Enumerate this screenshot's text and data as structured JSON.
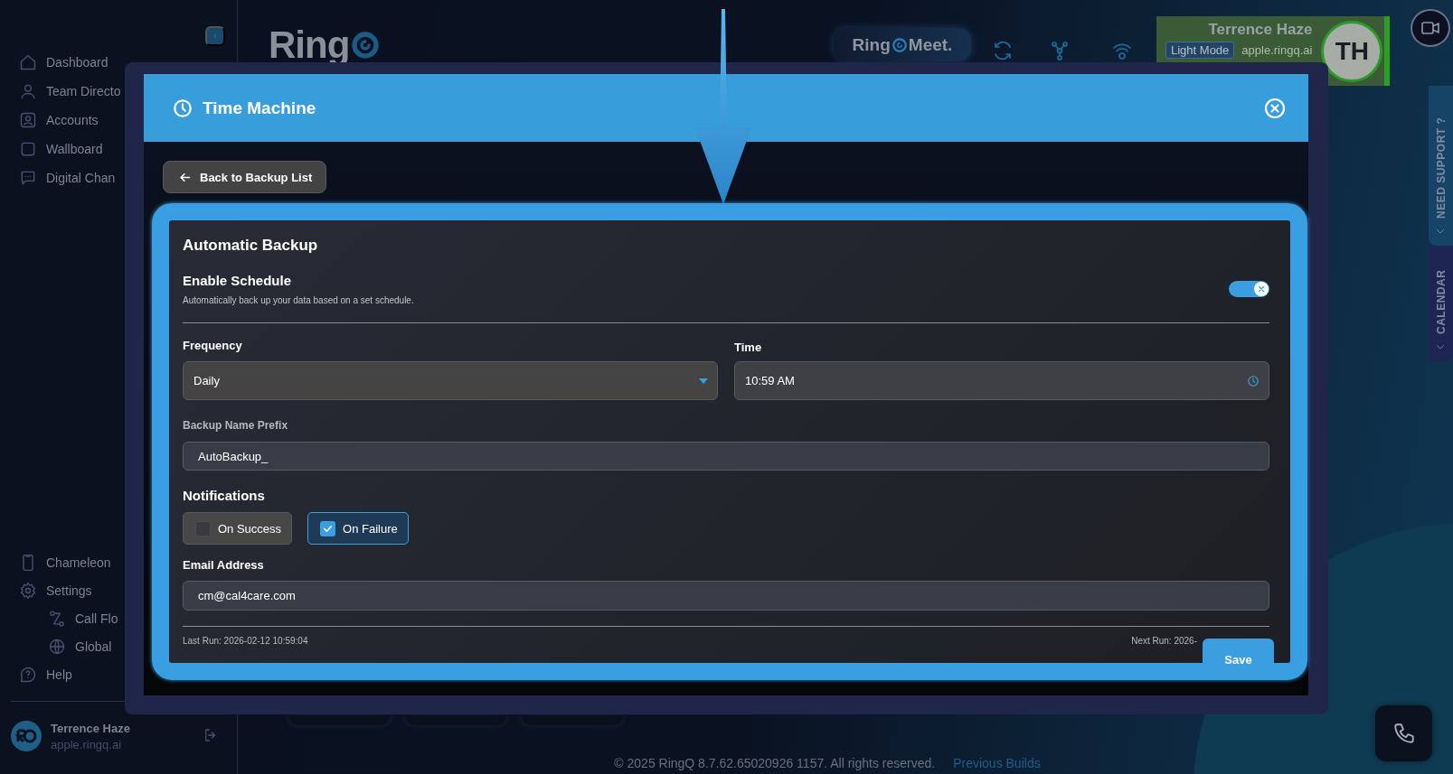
{
  "sidebar": {
    "nav_items": [
      {
        "label": "Dashboard",
        "selected": false
      },
      {
        "label": "Team Directo",
        "selected": false
      },
      {
        "label": "Accounts",
        "selected": false
      },
      {
        "label": "Wallboard",
        "selected": false
      },
      {
        "label": "Digital Chan",
        "selected": false
      }
    ],
    "bottom_items": [
      {
        "label": "Chameleon",
        "selected": false
      },
      {
        "label": "Settings",
        "selected": false,
        "children": [
          {
            "label": "Call Flo",
            "selected": false
          },
          {
            "label": "Global",
            "selected": false
          }
        ]
      },
      {
        "label": "Help",
        "selected": false
      }
    ],
    "user": {
      "name": "Terrence Haze",
      "domain": "apple.ringq.ai"
    }
  },
  "topbar": {
    "logo": "Ring",
    "meet_button": {
      "prefix": "Ring",
      "suffix": "Meet."
    },
    "profile": {
      "name": "Terrence Haze",
      "mode_button": "Light Mode",
      "domain": "apple.ringq.ai",
      "initials": "TH"
    }
  },
  "side_tabs": [
    {
      "label": "NEED SUPPORT ?"
    },
    {
      "label": "CALENDAR"
    }
  ],
  "modal": {
    "title": "Time Machine",
    "back_button": "Back to Backup List",
    "card": {
      "title": "Automatic Backup",
      "schedule": {
        "label": "Enable Schedule",
        "description": "Automatically back up your data based on a set schedule.",
        "on": true
      },
      "frequency": {
        "label": "Frequency",
        "value": "Daily"
      },
      "time": {
        "label": "Time",
        "value": "10:59 AM"
      },
      "prefix": {
        "label": "Backup Name Prefix",
        "value": "AutoBackup_"
      },
      "notifications": {
        "label": "Notifications",
        "options": [
          {
            "label": "On Success",
            "checked": false
          },
          {
            "label": "On Failure",
            "checked": true
          }
        ]
      },
      "email": {
        "label": "Email Address",
        "value": "cm@cal4care.com"
      },
      "last_run": "Last Run: 2026-02-12 10:59:04",
      "next_run": "Next Run: 2026-",
      "save_button": "Save"
    }
  },
  "footer": {
    "copyright": "© 2025 RingQ 8.7.62.65020926 1157. All rights reserved.",
    "link": "Previous Builds"
  }
}
